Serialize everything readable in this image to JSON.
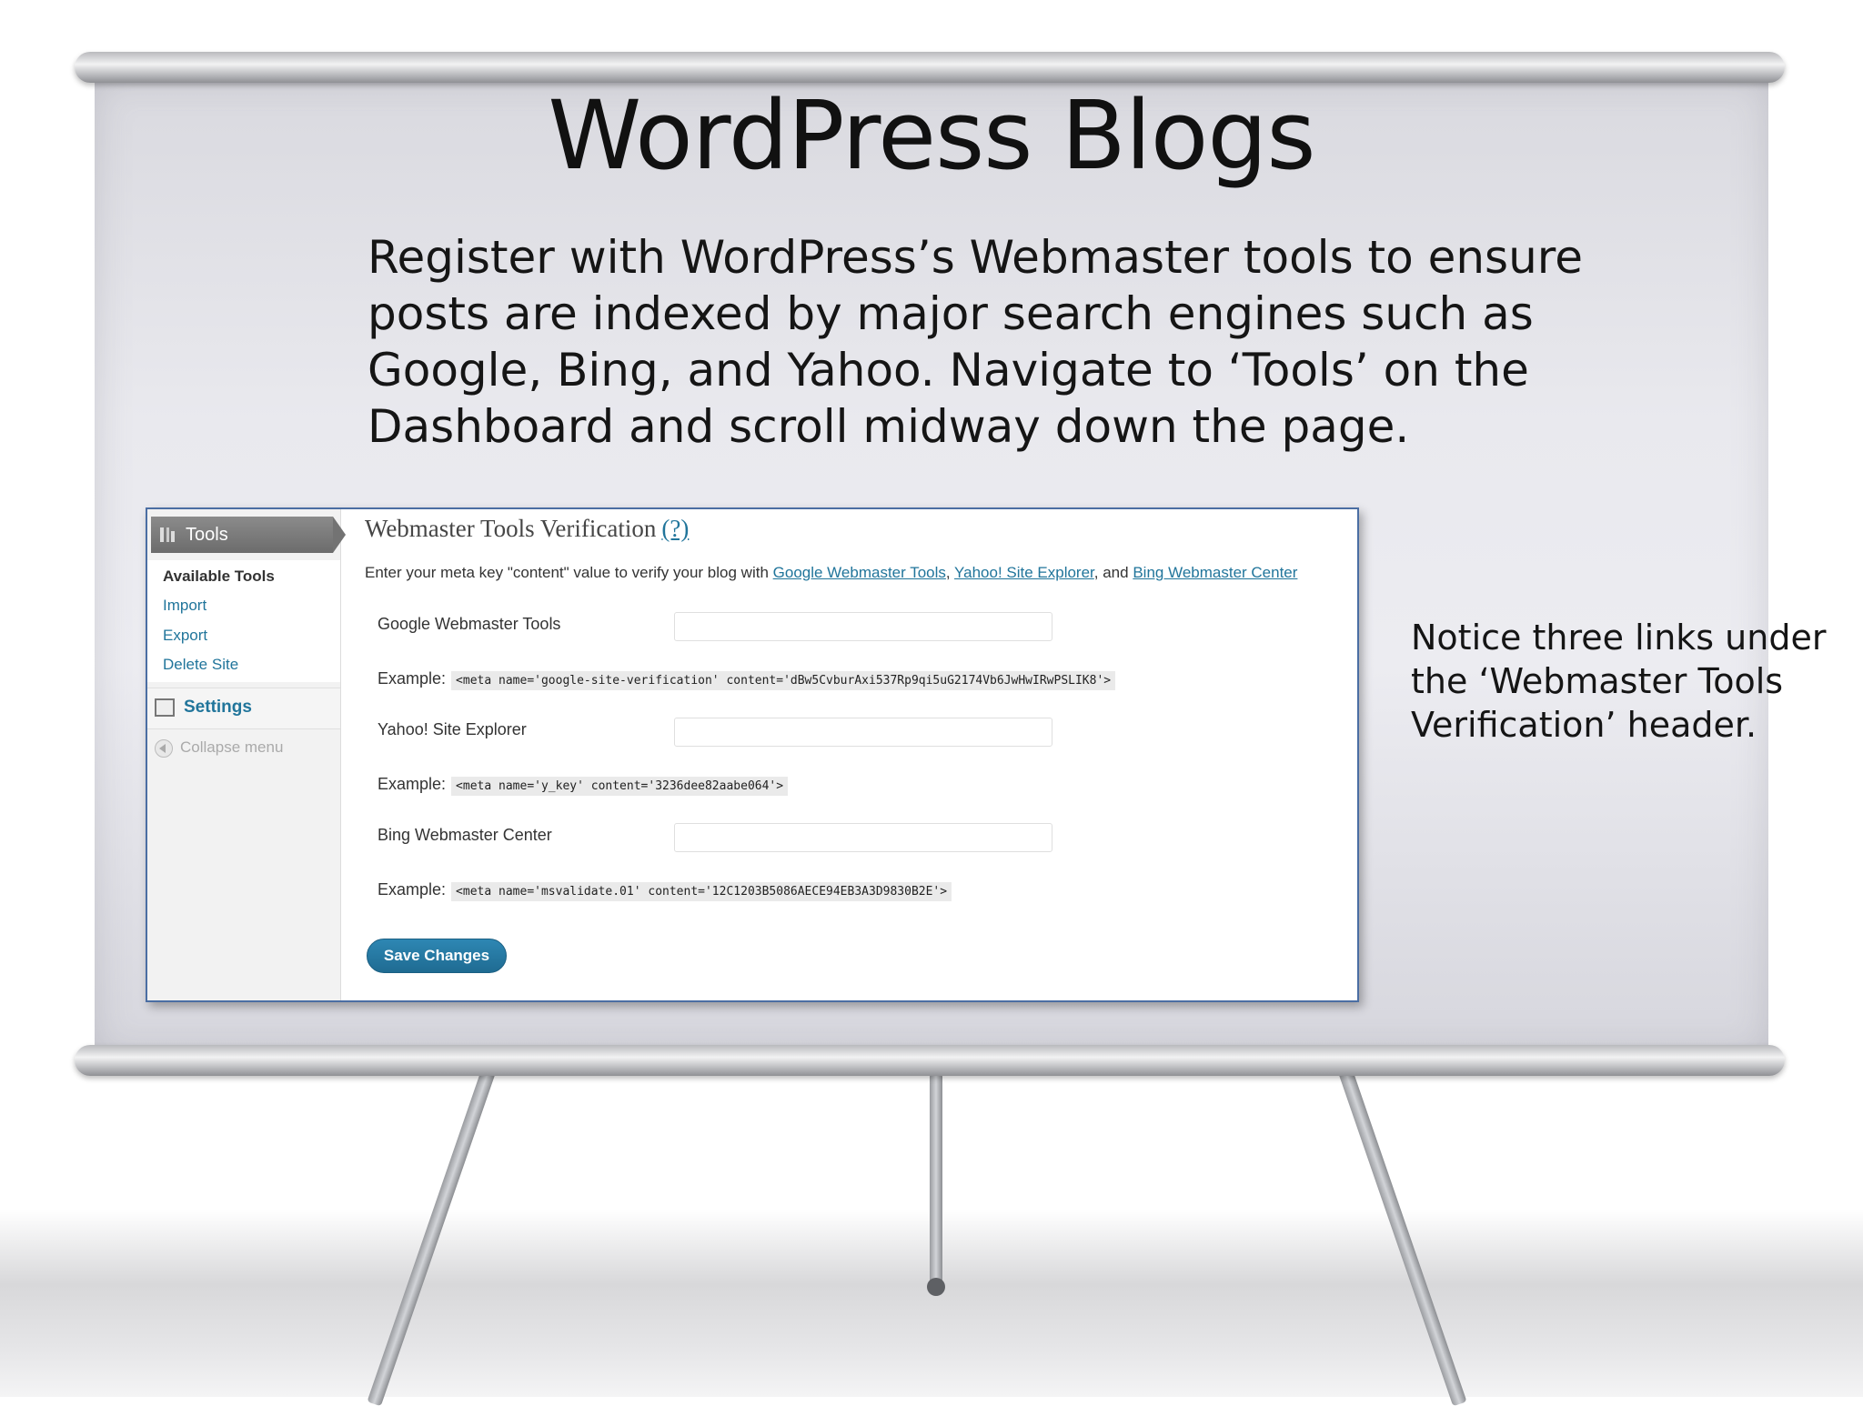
{
  "slide": {
    "title": "WordPress Blogs",
    "body": "Register with WordPress’s Webmaster tools to ensure posts are indexed by major search engines such as Google, Bing, and Yahoo. Navigate to ‘Tools’ on the Dashboard and scroll midway down the page.",
    "note": "Notice three links under the ‘Webmaster Tools Verification’ header."
  },
  "sidebar": {
    "tools_label": "Tools",
    "submenu": [
      "Available Tools",
      "Import",
      "Export",
      "Delete Site"
    ],
    "settings_label": "Settings",
    "collapse_label": "Collapse menu"
  },
  "main": {
    "heading": "Webmaster Tools Verification",
    "help_link": "(?)",
    "intro_prefix": "Enter your meta key \"content\" value to verify your blog with",
    "links": [
      "Google Webmaster Tools",
      "Yahoo! Site Explorer",
      "Bing Webmaster Center"
    ],
    "intro_sep1": ",",
    "intro_sep2": ", and",
    "fields": [
      {
        "label": "Google Webmaster Tools",
        "value": "",
        "example_label": "Example:",
        "example": "<meta name='google-site-verification' content='dBw5CvburAxi537Rp9qi5uG2174Vb6JwHwIRwPSLIK8'>"
      },
      {
        "label": "Yahoo! Site Explorer",
        "value": "",
        "example_label": "Example:",
        "example": "<meta name='y_key' content='3236dee82aabe064'>"
      },
      {
        "label": "Bing Webmaster Center",
        "value": "",
        "example_label": "Example:",
        "example": "<meta name='msvalidate.01' content='12C1203B5086AECE94EB3A3D9830B2E'>"
      }
    ],
    "save_label": "Save Changes"
  },
  "colors": {
    "link": "#21759b",
    "button": "#21759b",
    "frame_border": "#4b6ea3"
  }
}
